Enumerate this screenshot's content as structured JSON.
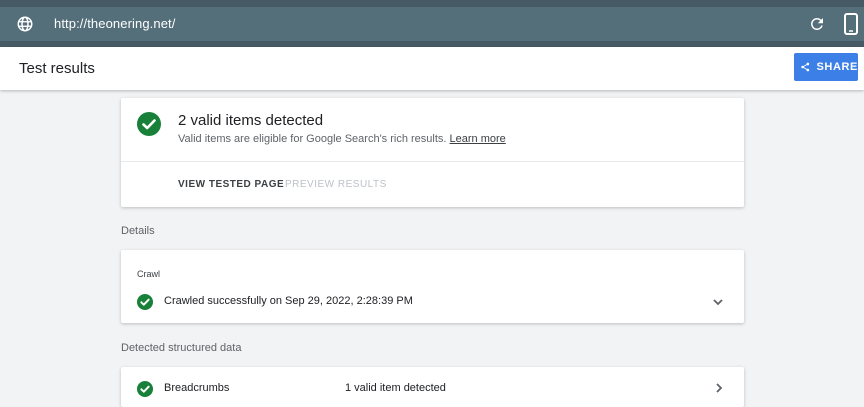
{
  "browser": {
    "url": "http://theonering.net/",
    "icons": {
      "site": "globe-icon",
      "reload": "reload-icon",
      "device": "mobile-device-icon"
    }
  },
  "header": {
    "title": "Test results",
    "share_label": "SHARE",
    "share_color": "#3c7fe6"
  },
  "summary": {
    "title": "2 valid items detected",
    "subtitle": "Valid items are eligible for Google Search's rich results.",
    "learn_more": "Learn more",
    "actions": {
      "view_tested_page": "VIEW TESTED PAGE",
      "preview_results": "PREVIEW RESULTS"
    },
    "status_color": "#188038"
  },
  "details": {
    "section_label": "Details",
    "crawl": {
      "label": "Crawl",
      "status_text": "Crawled successfully on Sep 29, 2022, 2:28:39 PM"
    }
  },
  "structured_data": {
    "section_label": "Detected structured data",
    "items": [
      {
        "name": "Breadcrumbs",
        "status": "1 valid item detected"
      }
    ]
  }
}
